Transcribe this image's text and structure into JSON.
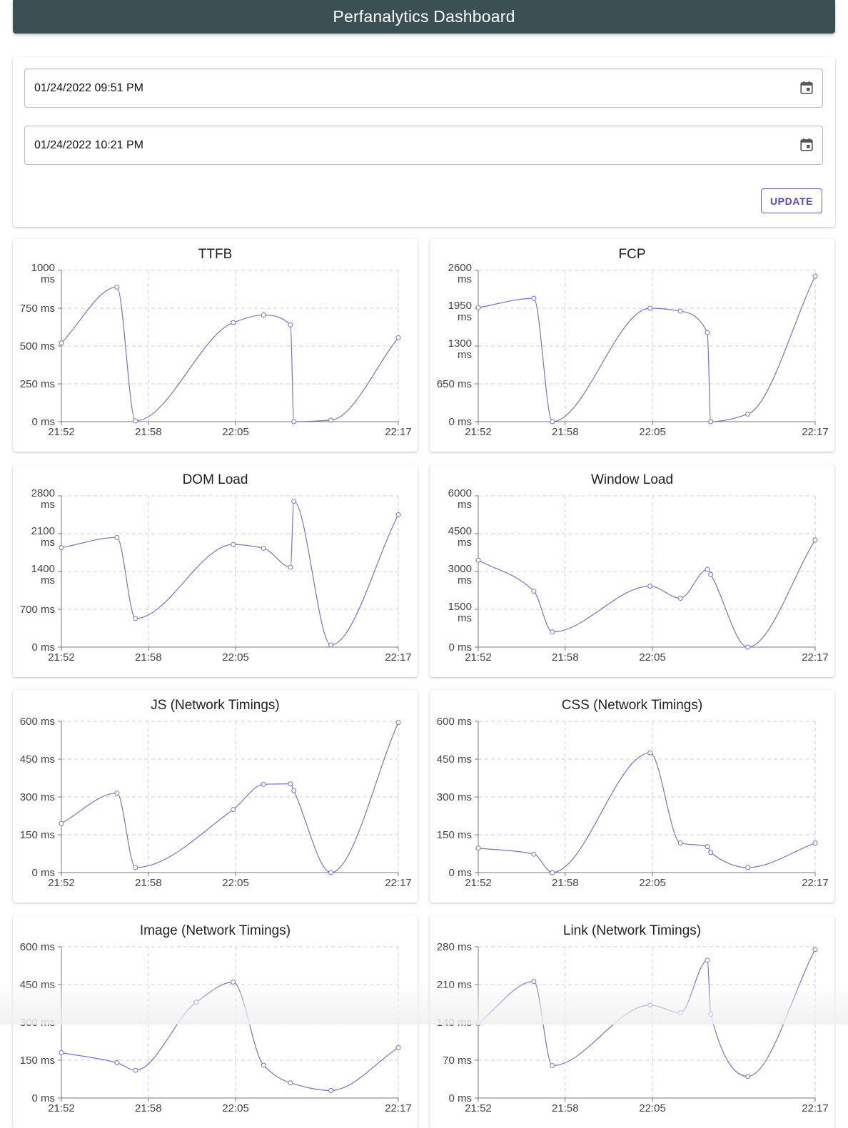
{
  "app": {
    "title": "Perfanalytics Dashboard"
  },
  "filters": {
    "start": {
      "value": "01/24/2022 09:51 PM",
      "icon": "calendar-icon"
    },
    "end": {
      "value": "01/24/2022 10:21 PM",
      "icon": "calendar-icon"
    },
    "update_label": "UPDATE"
  },
  "colors": {
    "appbar": "#3a5052",
    "series": "#7b6fd0",
    "button": "#5b45b3",
    "grid": "#cfcfcf"
  },
  "chart_data": [
    {
      "id": "ttfb",
      "type": "line",
      "title": "TTFB",
      "xticks": [
        "21:52",
        "21:58",
        "22:05",
        "22:17"
      ],
      "xlim": [
        0,
        1
      ],
      "yticks": [
        0,
        250,
        500,
        750,
        1000
      ],
      "ytick_labels": [
        "0 ms",
        "250 ms",
        "500 ms",
        "750 ms",
        "1000 ms"
      ],
      "ylim": [
        0,
        1000
      ],
      "points": [
        [
          0.0,
          520
        ],
        [
          0.165,
          890
        ],
        [
          0.22,
          5
        ],
        [
          0.51,
          655
        ],
        [
          0.6,
          705
        ],
        [
          0.68,
          640
        ],
        [
          0.69,
          0
        ],
        [
          0.8,
          10
        ],
        [
          1.0,
          555
        ]
      ]
    },
    {
      "id": "fcp",
      "type": "line",
      "title": "FCP",
      "xticks": [
        "21:52",
        "21:58",
        "22:05",
        "22:17"
      ],
      "xlim": [
        0,
        1
      ],
      "yticks": [
        0,
        650,
        1300,
        1950,
        2600
      ],
      "ytick_labels": [
        "0 ms",
        "650 ms",
        "1300 ms",
        "1950 ms",
        "2600 ms"
      ],
      "ylim": [
        0,
        2600
      ],
      "points": [
        [
          0.0,
          1960
        ],
        [
          0.165,
          2120
        ],
        [
          0.22,
          0
        ],
        [
          0.51,
          1950
        ],
        [
          0.6,
          1900
        ],
        [
          0.68,
          1530
        ],
        [
          0.69,
          0
        ],
        [
          0.8,
          130
        ],
        [
          1.0,
          2500
        ]
      ]
    },
    {
      "id": "dom-load",
      "type": "line",
      "title": "DOM Load",
      "xticks": [
        "21:52",
        "21:58",
        "22:05",
        "22:17"
      ],
      "xlim": [
        0,
        1
      ],
      "yticks": [
        0,
        700,
        1400,
        2100,
        2800
      ],
      "ytick_labels": [
        "0 ms",
        "700 ms",
        "1400 ms",
        "2100 ms",
        "2800 ms"
      ],
      "ylim": [
        0,
        2800
      ],
      "points": [
        [
          0.0,
          1840
        ],
        [
          0.165,
          2030
        ],
        [
          0.22,
          530
        ],
        [
          0.51,
          1900
        ],
        [
          0.6,
          1830
        ],
        [
          0.68,
          1480
        ],
        [
          0.69,
          2700
        ],
        [
          0.8,
          40
        ],
        [
          1.0,
          2450
        ]
      ]
    },
    {
      "id": "window-load",
      "type": "line",
      "title": "Window Load",
      "xticks": [
        "21:52",
        "21:58",
        "22:05",
        "22:17"
      ],
      "xlim": [
        0,
        1
      ],
      "yticks": [
        0,
        1500,
        3000,
        4500,
        6000
      ],
      "ytick_labels": [
        "0 ms",
        "1500 ms",
        "3000 ms",
        "4500 ms",
        "6000 ms"
      ],
      "ylim": [
        0,
        6000
      ],
      "points": [
        [
          0.0,
          3450
        ],
        [
          0.165,
          2220
        ],
        [
          0.22,
          600
        ],
        [
          0.51,
          2420
        ],
        [
          0.6,
          1940
        ],
        [
          0.68,
          3080
        ],
        [
          0.69,
          2880
        ],
        [
          0.8,
          0
        ],
        [
          1.0,
          4250
        ]
      ]
    },
    {
      "id": "js-network",
      "type": "line",
      "title": "JS (Network Timings)",
      "xticks": [
        "21:52",
        "21:58",
        "22:05",
        "22:17"
      ],
      "xlim": [
        0,
        1
      ],
      "yticks": [
        0,
        150,
        300,
        450,
        600
      ],
      "ytick_labels": [
        "0 ms",
        "150 ms",
        "300 ms",
        "450 ms",
        "600 ms"
      ],
      "ylim": [
        0,
        600
      ],
      "points": [
        [
          0.0,
          195
        ],
        [
          0.165,
          315
        ],
        [
          0.22,
          20
        ],
        [
          0.51,
          250
        ],
        [
          0.6,
          350
        ],
        [
          0.68,
          352
        ],
        [
          0.69,
          325
        ],
        [
          0.8,
          0
        ],
        [
          1.0,
          595
        ]
      ]
    },
    {
      "id": "css-network",
      "type": "line",
      "title": "CSS (Network Timings)",
      "xticks": [
        "21:52",
        "21:58",
        "22:05",
        "22:17"
      ],
      "xlim": [
        0,
        1
      ],
      "yticks": [
        0,
        150,
        300,
        450,
        600
      ],
      "ytick_labels": [
        "0 ms",
        "150 ms",
        "300 ms",
        "450 ms",
        "600 ms"
      ],
      "ylim": [
        0,
        600
      ],
      "points": [
        [
          0.0,
          97
        ],
        [
          0.165,
          73
        ],
        [
          0.22,
          0
        ],
        [
          0.51,
          475
        ],
        [
          0.6,
          117
        ],
        [
          0.68,
          103
        ],
        [
          0.69,
          80
        ],
        [
          0.8,
          20
        ],
        [
          1.0,
          117
        ]
      ]
    },
    {
      "id": "image-network",
      "type": "line",
      "title": "Image (Network Timings)",
      "xticks": [
        "21:52",
        "21:58",
        "22:05",
        "22:17"
      ],
      "xlim": [
        0,
        1
      ],
      "yticks": [
        0,
        150,
        300,
        450,
        600
      ],
      "ytick_labels": [
        "0 ms",
        "150 ms",
        "300 ms",
        "450 ms",
        "600 ms"
      ],
      "ylim": [
        0,
        600
      ],
      "points": [
        [
          0.0,
          180
        ],
        [
          0.165,
          140
        ],
        [
          0.22,
          110
        ],
        [
          0.4,
          380
        ],
        [
          0.51,
          460
        ],
        [
          0.6,
          130
        ],
        [
          0.68,
          60
        ],
        [
          0.8,
          30
        ],
        [
          1.0,
          200
        ]
      ]
    },
    {
      "id": "link-network",
      "type": "line",
      "title": "Link (Network Timings)",
      "xticks": [
        "21:52",
        "21:58",
        "22:05",
        "22:17"
      ],
      "xlim": [
        0,
        1
      ],
      "yticks": [
        0,
        70,
        140,
        210,
        280
      ],
      "ytick_labels": [
        "0 ms",
        "70 ms",
        "140 ms",
        "210 ms",
        "280 ms"
      ],
      "ylim": [
        0,
        280
      ],
      "points": [
        [
          0.0,
          138
        ],
        [
          0.165,
          216
        ],
        [
          0.22,
          60
        ],
        [
          0.51,
          172
        ],
        [
          0.6,
          158
        ],
        [
          0.68,
          255
        ],
        [
          0.69,
          155
        ],
        [
          0.8,
          40
        ],
        [
          1.0,
          275
        ]
      ]
    }
  ]
}
